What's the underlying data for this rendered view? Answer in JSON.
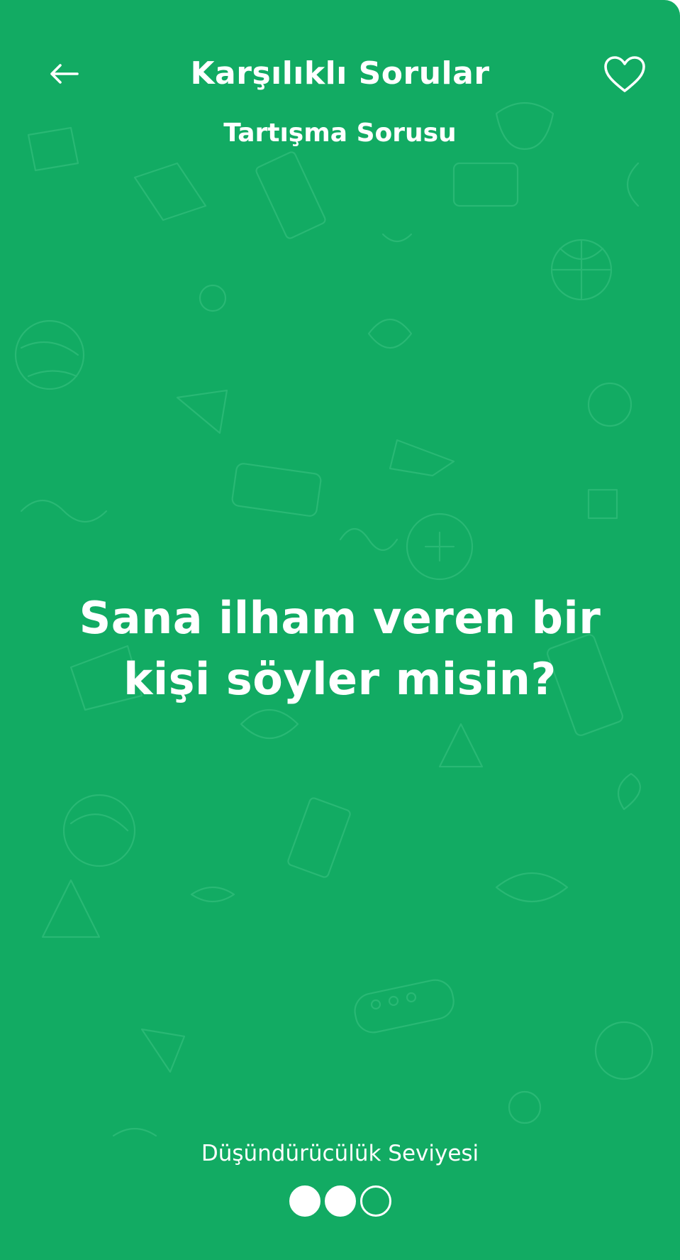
{
  "header": {
    "title": "Karşılıklı Sorular",
    "subtitle": "Tartışma Sorusu",
    "back_icon": "arrow-left-icon",
    "favorite_icon": "heart-outline-icon"
  },
  "question": {
    "line1": "Sana ilham veren bir",
    "line2": "kişi söyler misin?"
  },
  "level": {
    "label": "Düşündürücülük Seviyesi",
    "value": 2,
    "max": 3
  },
  "colors": {
    "background": "#12ab63",
    "foreground": "#ffffff"
  }
}
